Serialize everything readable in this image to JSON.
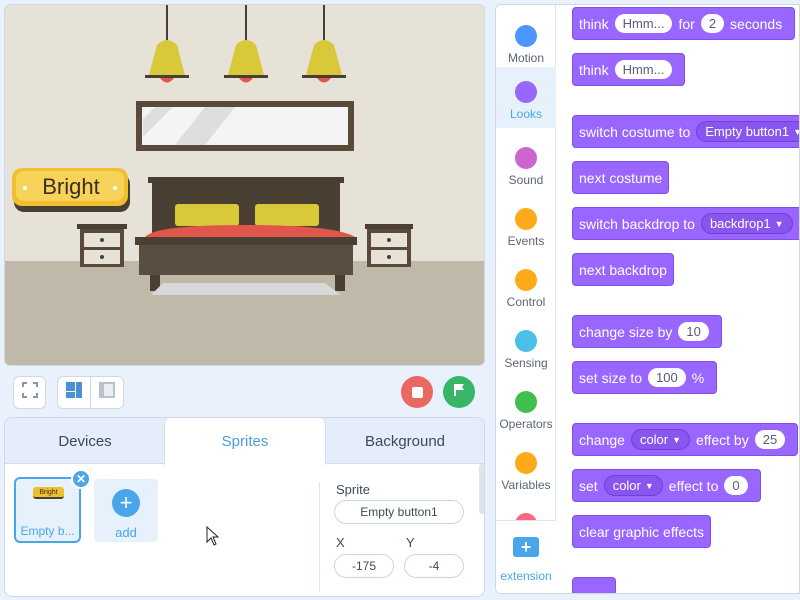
{
  "stage": {
    "sprite_label": "Bright"
  },
  "controls": {
    "fullscreen_icon": "fullscreen-icon",
    "layout_icons": [
      "layout-small-stage-icon",
      "layout-large-stage-icon"
    ],
    "stop_color": "#e9685f",
    "go_color": "#39b56a"
  },
  "panel": {
    "tabs": [
      {
        "label": "Devices"
      },
      {
        "label": "Sprites"
      },
      {
        "label": "Background"
      }
    ],
    "active_tab": "Sprites",
    "sprite_card": {
      "thumb_text": "Bright",
      "label": "Empty b..."
    },
    "add_card": {
      "label": "add"
    },
    "fields": {
      "sprite_label": "Sprite",
      "sprite_value": "Empty button1",
      "x_label": "X",
      "x_value": "-175",
      "y_label": "Y",
      "y_value": "-4"
    }
  },
  "categories": [
    {
      "name": "Motion",
      "color": "#4c97ff"
    },
    {
      "name": "Looks",
      "color": "#9966ff"
    },
    {
      "name": "Sound",
      "color": "#cf63cf"
    },
    {
      "name": "Events",
      "color": "#ffab19"
    },
    {
      "name": "Control",
      "color": "#ffab19"
    },
    {
      "name": "Sensing",
      "color": "#4cbfe6"
    },
    {
      "name": "Operators",
      "color": "#40bf4a"
    }
  ],
  "partial_categories": [
    {
      "name": "Variables",
      "color": "#ff8c1a"
    },
    {
      "name": "",
      "color": "#ff6680"
    }
  ],
  "active_category": "Looks",
  "extension": {
    "label": "extension",
    "icon": "+"
  },
  "blocks": {
    "think_for": {
      "t1": "think",
      "v1": "Hmm...",
      "t2": "for",
      "v2": "2",
      "t3": "seconds"
    },
    "think": {
      "t1": "think",
      "v1": "Hmm..."
    },
    "switch_costume": {
      "t1": "switch costume to",
      "v1": "Empty button1"
    },
    "next_costume": {
      "t1": "next costume"
    },
    "switch_backdrop": {
      "t1": "switch backdrop to",
      "v1": "backdrop1"
    },
    "next_backdrop": {
      "t1": "next backdrop"
    },
    "change_size": {
      "t1": "change size by",
      "v1": "10"
    },
    "set_size": {
      "t1": "set size to",
      "v1": "100",
      "t2": "%"
    },
    "change_effect": {
      "t1": "change",
      "v1": "color",
      "t2": "effect by",
      "v2": "25"
    },
    "set_effect": {
      "t1": "set",
      "v1": "color",
      "t2": "effect to",
      "v2": "0"
    },
    "clear_effects": {
      "t1": "clear graphic effects"
    }
  }
}
